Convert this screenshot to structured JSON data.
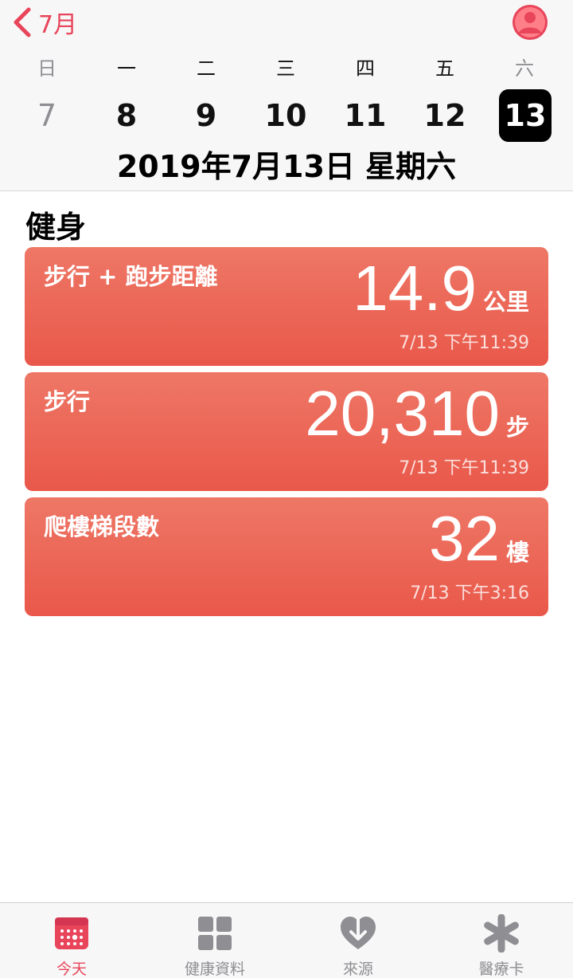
{
  "header": {
    "back_label": "7月",
    "weekdays": [
      "日",
      "一",
      "二",
      "三",
      "四",
      "五",
      "六"
    ],
    "dates": [
      "7",
      "8",
      "9",
      "10",
      "11",
      "12",
      "13"
    ],
    "selected_date": "13",
    "full_date": "2019年7月13日 星期六"
  },
  "section": {
    "title": "健身"
  },
  "cards": [
    {
      "title": "步行 + 跑步距離",
      "value": "14.9",
      "unit": "公里",
      "time": "7/13 下午11:39"
    },
    {
      "title": "步行",
      "value": "20,310",
      "unit": "步",
      "time": "7/13 下午11:39"
    },
    {
      "title": "爬樓梯段數",
      "value": "32",
      "unit": "樓",
      "time": "7/13 下午3:16"
    }
  ],
  "tabs": [
    {
      "label": "今天",
      "icon": "calendar-icon",
      "active": true
    },
    {
      "label": "健康資料",
      "icon": "grid-icon",
      "active": false
    },
    {
      "label": "來源",
      "icon": "heart-download-icon",
      "active": false
    },
    {
      "label": "醫療卡",
      "icon": "asterisk-icon",
      "active": false
    }
  ],
  "colors": {
    "accent": "#e8445a",
    "card_top": "#ee7766",
    "card_bottom": "#e9584a",
    "inactive": "#8e8e93"
  }
}
